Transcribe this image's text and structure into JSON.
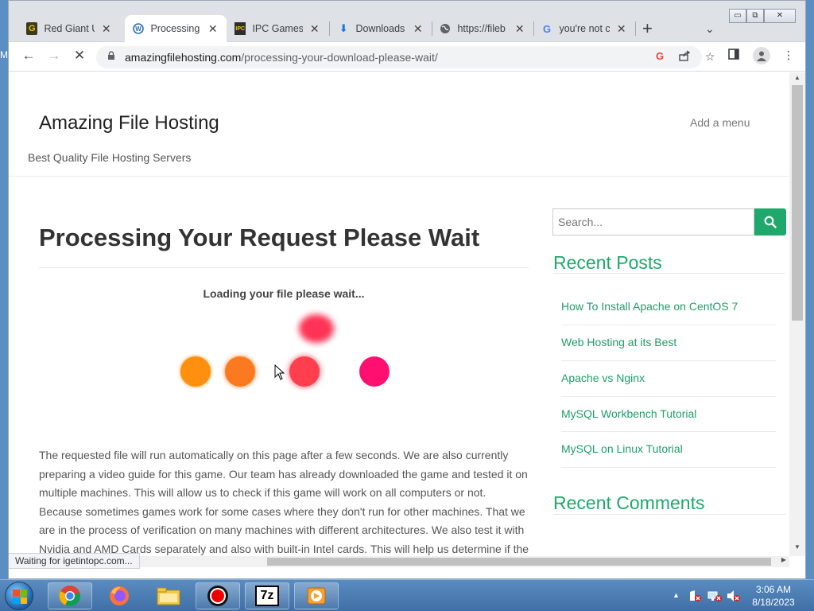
{
  "desktop": {
    "edge_letter": "M"
  },
  "tabs": [
    {
      "title": "Red Giant U",
      "favicon": "G",
      "favicon_color": "#3b3a1c",
      "active": false
    },
    {
      "title": "Processing",
      "favicon": "W",
      "favicon_color": "#2b6fb5",
      "active": true
    },
    {
      "title": "IPC Games",
      "favicon": "IPC",
      "favicon_color": "#2d2d2d",
      "active": false
    },
    {
      "title": "Downloads",
      "favicon": "⬇",
      "favicon_color": "#1a73e8",
      "active": false
    },
    {
      "title": "https://fileb",
      "favicon": "🌐",
      "favicon_color": "#5f6368",
      "active": false
    },
    {
      "title": "you're not c",
      "favicon": "G",
      "favicon_color": "#4285f4",
      "active": false
    }
  ],
  "tabstrip": {
    "new_tab": "+",
    "tab_search": "⌄"
  },
  "window_controls": {
    "minimize": "▭",
    "restore": "⧉",
    "close": "✕"
  },
  "toolbar": {
    "back": "←",
    "forward": "→",
    "stop": "✕",
    "url_host": "amazingfilehosting.com",
    "url_path": "/processing-your-download-please-wait/"
  },
  "site": {
    "title": "Amazing File Hosting",
    "tagline": "Best Quality File Hosting Servers",
    "menu": "Add a menu"
  },
  "main": {
    "heading": "Processing Your Request Please Wait",
    "loading_text": "Loading your file please wait...",
    "body": "The requested file will run automatically on this page after a few seconds. We are also currently preparing a video guide for this game. Our team has already downloaded the game and tested it on multiple machines. This will allow us to check if this game will work on all computers or not. Because sometimes games work for some cases where they don't run for other machines. That we are in the process of verification on many machines with different architectures. We also test it with Nvidia and AMD Cards separately and also with built-in Intel cards. This will help us determine if the"
  },
  "loader_dots": [
    {
      "color": "#ff8f0f"
    },
    {
      "color": "#fb7a1f"
    },
    {
      "color": "#ff3f4e"
    },
    {
      "color": "#ff0f6f"
    },
    {
      "color": "#ff3355"
    }
  ],
  "sidebar": {
    "search_placeholder": "Search...",
    "recent_posts_heading": "Recent Posts",
    "posts": [
      "How To Install Apache on CentOS 7",
      "Web Hosting at its Best",
      "Apache vs Nginx",
      "MySQL Workbench Tutorial",
      "MySQL on Linux Tutorial"
    ],
    "recent_comments_heading": "Recent Comments"
  },
  "status_bar": "Waiting for igetintopc.com...",
  "colors": {
    "accent": "#1ea86b",
    "link": "#1e9e68"
  },
  "taskbar": {
    "items": [
      "chrome-icon",
      "firefox-icon",
      "file-explorer-icon",
      "recorder-icon",
      "7zip-icon",
      "media-player-icon"
    ],
    "seven_zip_label": "7z",
    "clock_time": "3:06 AM",
    "clock_date": "8/18/2023"
  }
}
